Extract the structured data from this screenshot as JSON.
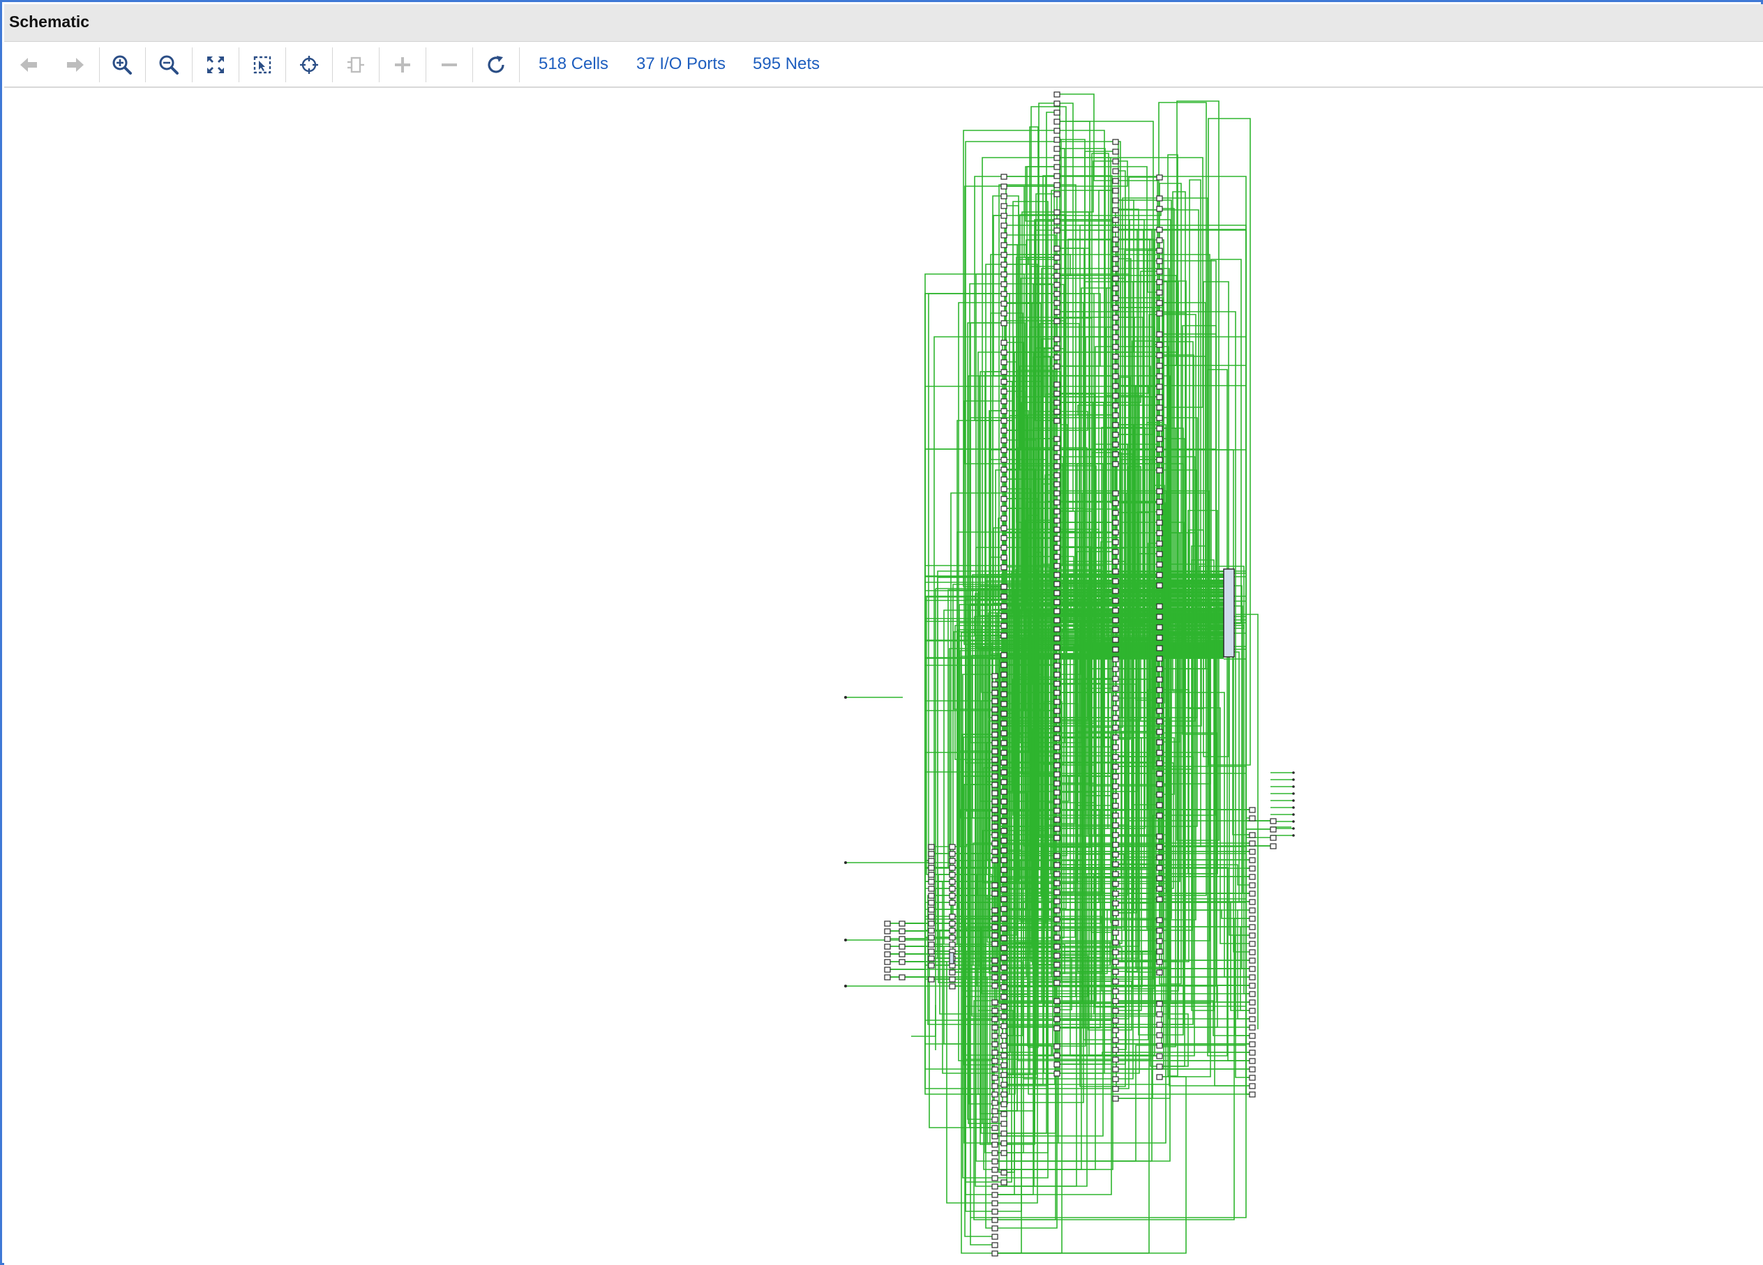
{
  "window": {
    "title": "Schematic"
  },
  "toolbar": {
    "buttons": [
      {
        "name": "back-button",
        "icon": "arrow-left-icon",
        "enabled": false
      },
      {
        "name": "forward-button",
        "icon": "arrow-right-icon",
        "enabled": false
      },
      {
        "name": "zoom-in-button",
        "icon": "zoom-in-icon",
        "enabled": true
      },
      {
        "name": "zoom-out-button",
        "icon": "zoom-out-icon",
        "enabled": true
      },
      {
        "name": "zoom-fit-button",
        "icon": "fit-icon",
        "enabled": true
      },
      {
        "name": "zoom-area-button",
        "icon": "zoom-area-icon",
        "enabled": true
      },
      {
        "name": "autofit-selection-button",
        "icon": "crosshair-icon",
        "enabled": true
      },
      {
        "name": "regenerate-button",
        "icon": "cell-icon",
        "enabled": false
      },
      {
        "name": "expand-button",
        "icon": "plus-icon",
        "enabled": false
      },
      {
        "name": "collapse-button",
        "icon": "minus-icon",
        "enabled": false
      },
      {
        "name": "refresh-button",
        "icon": "refresh-icon",
        "enabled": true
      }
    ],
    "stats": {
      "cells": "518 Cells",
      "io_ports": "37 I/O Ports",
      "nets": "595 Nets"
    }
  },
  "colors": {
    "wire": "#2fb52f",
    "cell_outline": "#2a2a2a",
    "block_fill": "#cfdcec",
    "link_text": "#1f5fbf",
    "frame_border": "#3f79d6"
  }
}
